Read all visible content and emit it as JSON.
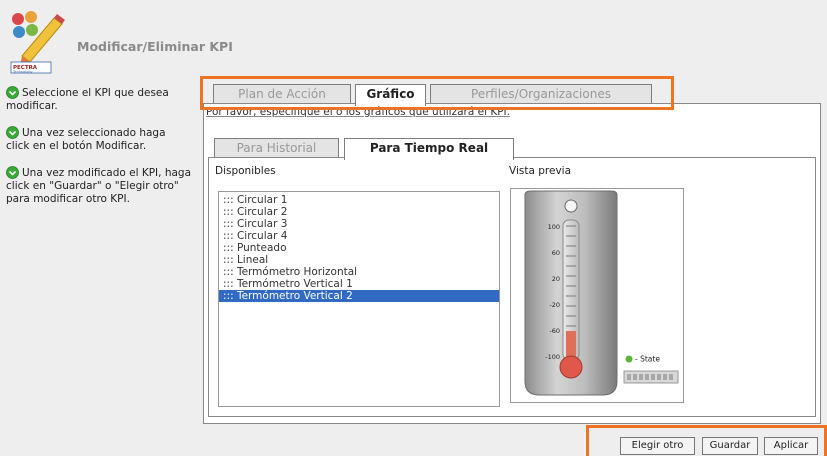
{
  "header": {
    "title": "Modificar/Eliminar KPI",
    "logo_text": "PECTRA Technology"
  },
  "sidebar": {
    "hints": [
      "Seleccione el KPI que desea modificar.",
      "Una vez seleccionado haga click en el botón Modificar.",
      "Una vez modificado el KPI, haga click en \"Guardar\" o \"Elegir otro\" para modificar otro KPI."
    ]
  },
  "tabs": [
    {
      "label": "Plan de Acción",
      "active": false
    },
    {
      "label": "Gráfico",
      "active": true
    },
    {
      "label": "Perfiles/Organizaciones",
      "active": false
    }
  ],
  "main": {
    "instruction": "Por favor, especifique el o los gráficos que utilizará el KPI.",
    "subtabs": [
      {
        "label": "Para Historial",
        "active": false
      },
      {
        "label": "Para Tiempo Real",
        "active": true
      }
    ],
    "available_label": "Disponibles",
    "preview_label": "Vista previa",
    "options": [
      "::: Circular 1",
      "::: Circular 2",
      "::: Circular 3",
      "::: Circular 4",
      "::: Punteado",
      "::: Lineal",
      "::: Termómetro Horizontal",
      "::: Termómetro Vertical 1",
      "::: Termómetro Vertical 2"
    ],
    "selected_option": "::: Termómetro Vertical 2",
    "thermometer": {
      "ticks": [
        "100",
        "60",
        "20",
        "-20",
        "-60",
        "-100"
      ],
      "legend": "- State",
      "status_color": "#5cb531"
    }
  },
  "buttons": {
    "choose_other": "Elegir otro",
    "save": "Guardar",
    "apply": "Aplicar"
  },
  "colors": {
    "highlight_orange": "#ee7322",
    "selection_blue": "#316ac5",
    "icon_green": "#3aa93a"
  }
}
